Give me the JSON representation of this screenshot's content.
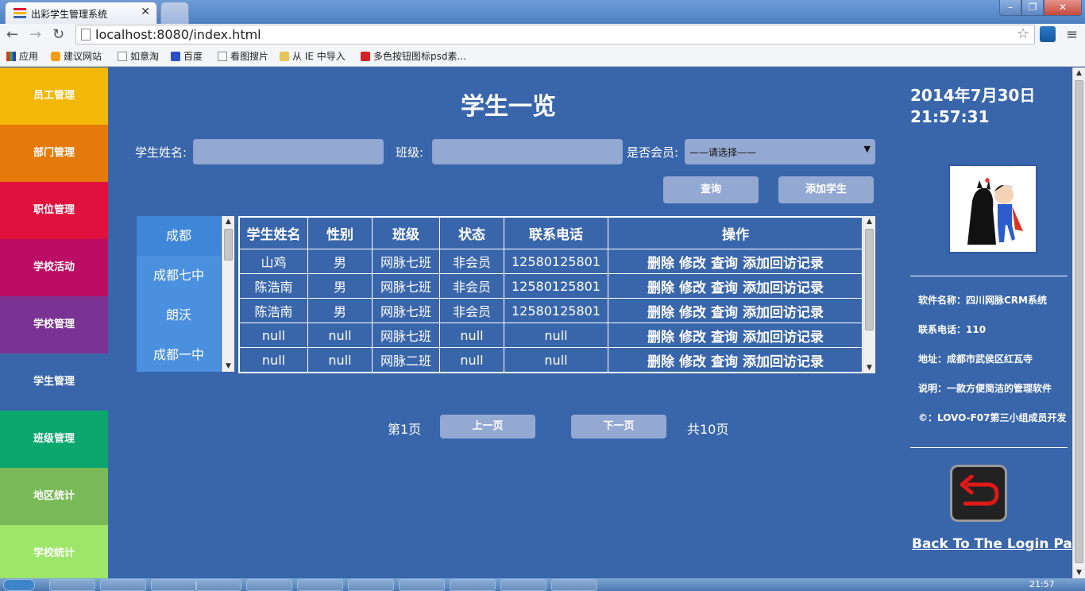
{
  "browser": {
    "tab_title": "出彩学生管理系统",
    "url": "localhost:8080/index.html",
    "bookmarks": [
      "应用",
      "建议网站",
      "如意淘",
      "百度",
      "看图搜片",
      "从 IE 中导入",
      "多色按钮图标psd素..."
    ]
  },
  "sidebar": {
    "items": [
      {
        "label": "员工管理",
        "color": "#f2b707"
      },
      {
        "label": "部门管理",
        "color": "#e57a0a"
      },
      {
        "label": "职位管理",
        "color": "#e0123d"
      },
      {
        "label": "学校活动",
        "color": "#bb0d63"
      },
      {
        "label": "学校管理",
        "color": "#7b3393"
      },
      {
        "label": "学生管理",
        "color": "#3966ab"
      },
      {
        "label": "班级管理",
        "color": "#0ba76e"
      },
      {
        "label": "地区统计",
        "color": "#7ab957"
      },
      {
        "label": "学校统计",
        "color": "#9de66a"
      }
    ]
  },
  "main": {
    "title": "学生一览",
    "search": {
      "name_label": "学生姓名:",
      "class_label": "班级:",
      "member_label": "是否会员:",
      "member_select_value": "——请选择——",
      "query_button": "查询",
      "add_button": "添加学生"
    },
    "school_list": [
      "成都",
      "成都七中",
      "朗沃",
      "成都一中"
    ],
    "table": {
      "headers": [
        "学生姓名",
        "性别",
        "班级",
        "状态",
        "联系电话",
        "操作"
      ],
      "rows": [
        {
          "name": "山鸡",
          "gender": "男",
          "class": "网脉七班",
          "status": "非会员",
          "phone": "12580125801"
        },
        {
          "name": "陈浩南",
          "gender": "男",
          "class": "网脉七班",
          "status": "非会员",
          "phone": "12580125801"
        },
        {
          "name": "陈浩南",
          "gender": "男",
          "class": "网脉七班",
          "status": "非会员",
          "phone": "12580125801"
        },
        {
          "name": "null",
          "gender": "null",
          "class": "网脉七班",
          "status": "null",
          "phone": "null"
        },
        {
          "name": "null",
          "gender": "null",
          "class": "网脉二班",
          "status": "null",
          "phone": "null"
        }
      ],
      "actions": [
        "删除",
        "修改",
        "查询",
        "添加回访记录"
      ]
    },
    "pager": {
      "current": "第1页",
      "prev": "上一页",
      "next": "下一页",
      "total": "共10页"
    }
  },
  "right_panel": {
    "date": "2014年7月30日",
    "time": "21:57:31",
    "info": [
      "软件名称：四川网脉CRM系统",
      "联系电话：110",
      "地址：成都市武侯区红瓦寺",
      "说明：一款方便简洁的管理软件",
      "©：LOVO-F07第三小组成员开发"
    ],
    "back_link": "Back To The Login Page"
  },
  "taskbar": {
    "clock": "21:57"
  }
}
